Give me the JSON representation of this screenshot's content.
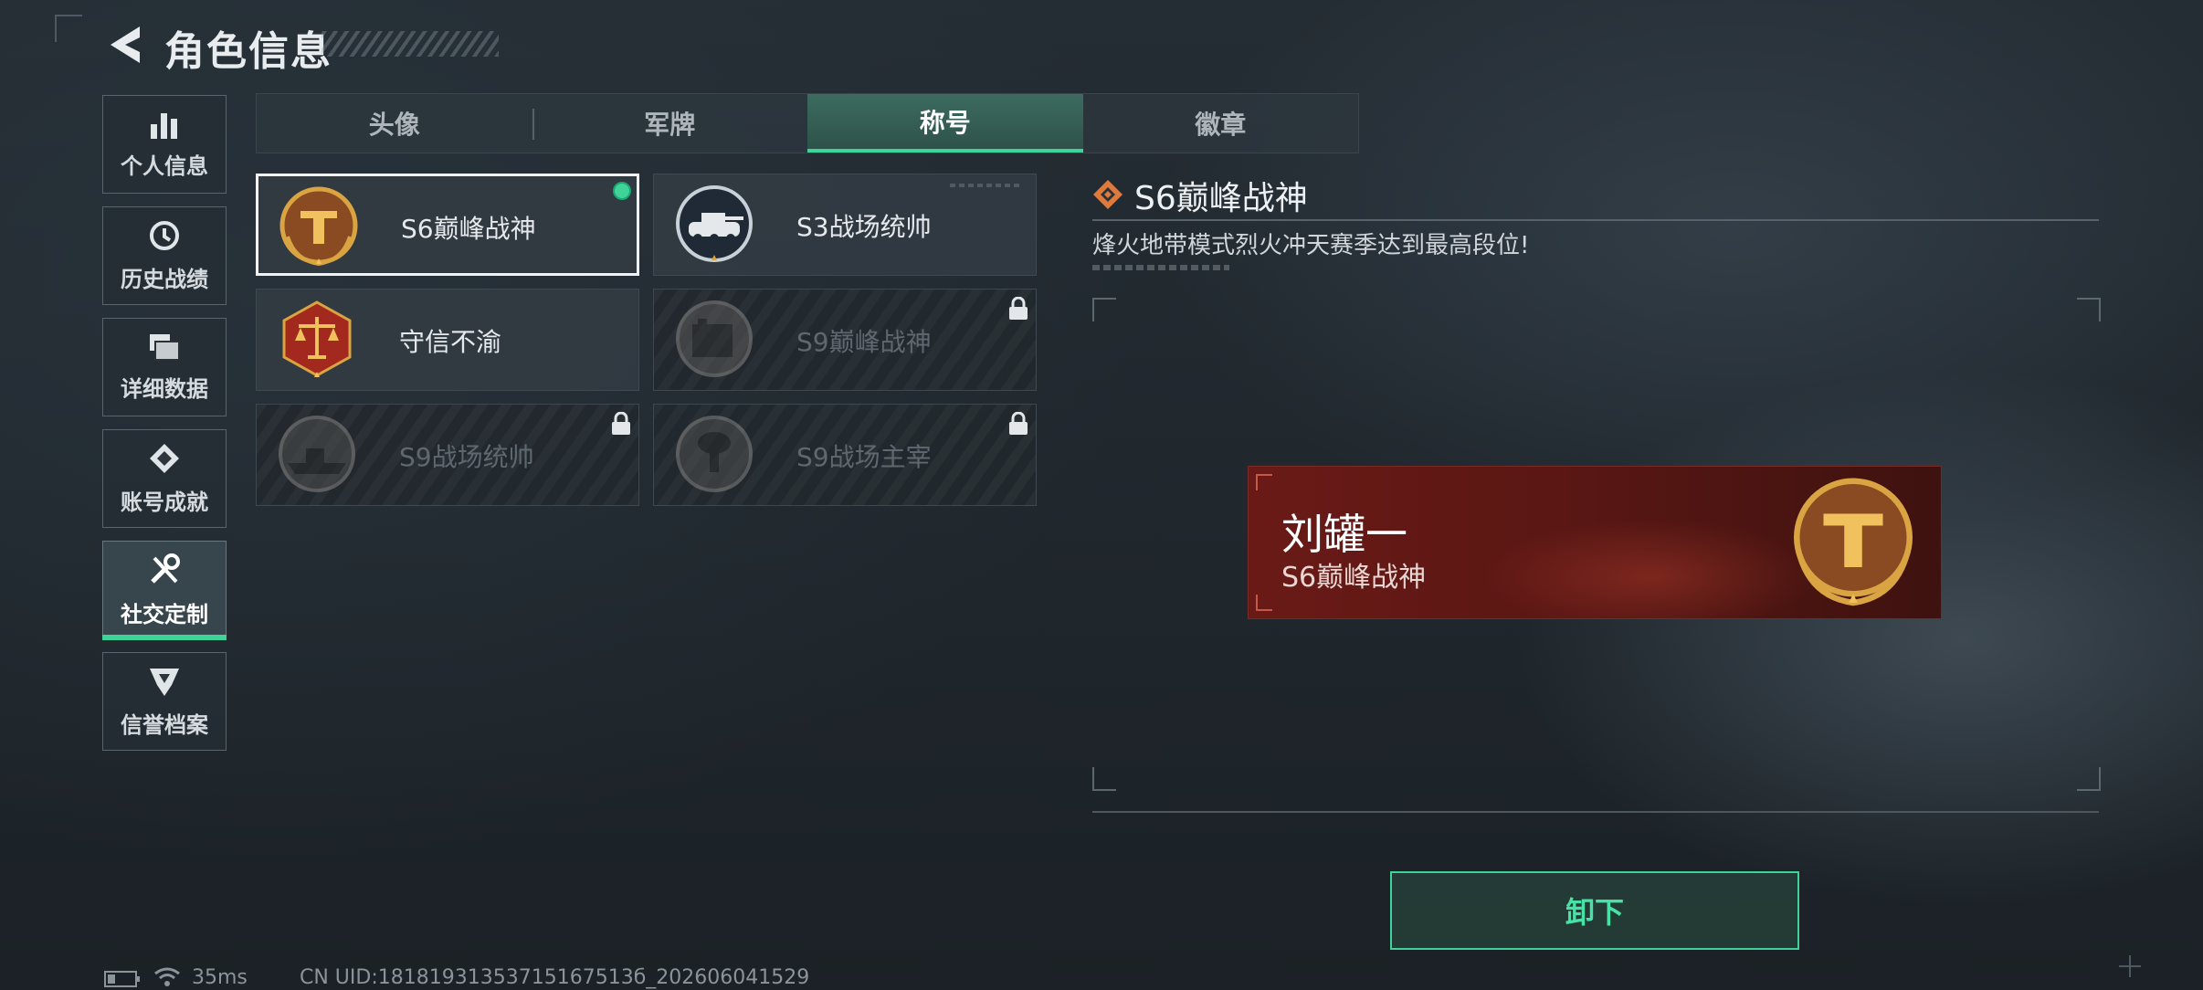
{
  "header": {
    "title": "角色信息",
    "back_icon": "back-chevron-icon"
  },
  "sidebar": {
    "active_index": 4,
    "items": [
      {
        "label": "个人信息",
        "icon": "bar-chart-icon"
      },
      {
        "label": "历史战绩",
        "icon": "history-clock-icon"
      },
      {
        "label": "详细数据",
        "icon": "folder-icon"
      },
      {
        "label": "账号成就",
        "icon": "achievement-icon"
      },
      {
        "label": "社交定制",
        "icon": "tools-icon"
      },
      {
        "label": "信誉档案",
        "icon": "credit-shield-icon"
      }
    ]
  },
  "tabs": [
    {
      "label": "头像"
    },
    {
      "label": "军牌"
    },
    {
      "label": "称号",
      "active": true
    },
    {
      "label": "徽章"
    }
  ],
  "titles": [
    {
      "name": "S6巅峰战神",
      "emblem": "golden-t-emblem",
      "selected": true,
      "equipped": true,
      "locked": false
    },
    {
      "name": "S3战场统帅",
      "emblem": "tank-emblem",
      "selected": false,
      "equipped": false,
      "locked": false
    },
    {
      "name": "守信不渝",
      "emblem": "scales-emblem",
      "selected": false,
      "equipped": false,
      "locked": false
    },
    {
      "name": "S9巅峰战神",
      "emblem": "fortress-emblem",
      "selected": false,
      "equipped": false,
      "locked": true
    },
    {
      "name": "S9战场统帅",
      "emblem": "warship-emblem",
      "selected": false,
      "equipped": false,
      "locked": true
    },
    {
      "name": "S9战场主宰",
      "emblem": "mushroom-cloud-emblem",
      "selected": false,
      "equipped": false,
      "locked": true
    }
  ],
  "detail": {
    "title": "S6巅峰战神",
    "description": "烽火地带模式烈火冲天赛季达到最高段位!",
    "preview": {
      "player_name": "刘罐一",
      "title": "S6巅峰战神"
    },
    "action_label": "卸下"
  },
  "status_bar": {
    "ping": "35ms",
    "uid": "CN UID:18181931353715167513б_202606041529"
  },
  "colors": {
    "accent": "#3fd39a",
    "banner": "#6a1a16",
    "emblem_gold": "#d9a441"
  }
}
